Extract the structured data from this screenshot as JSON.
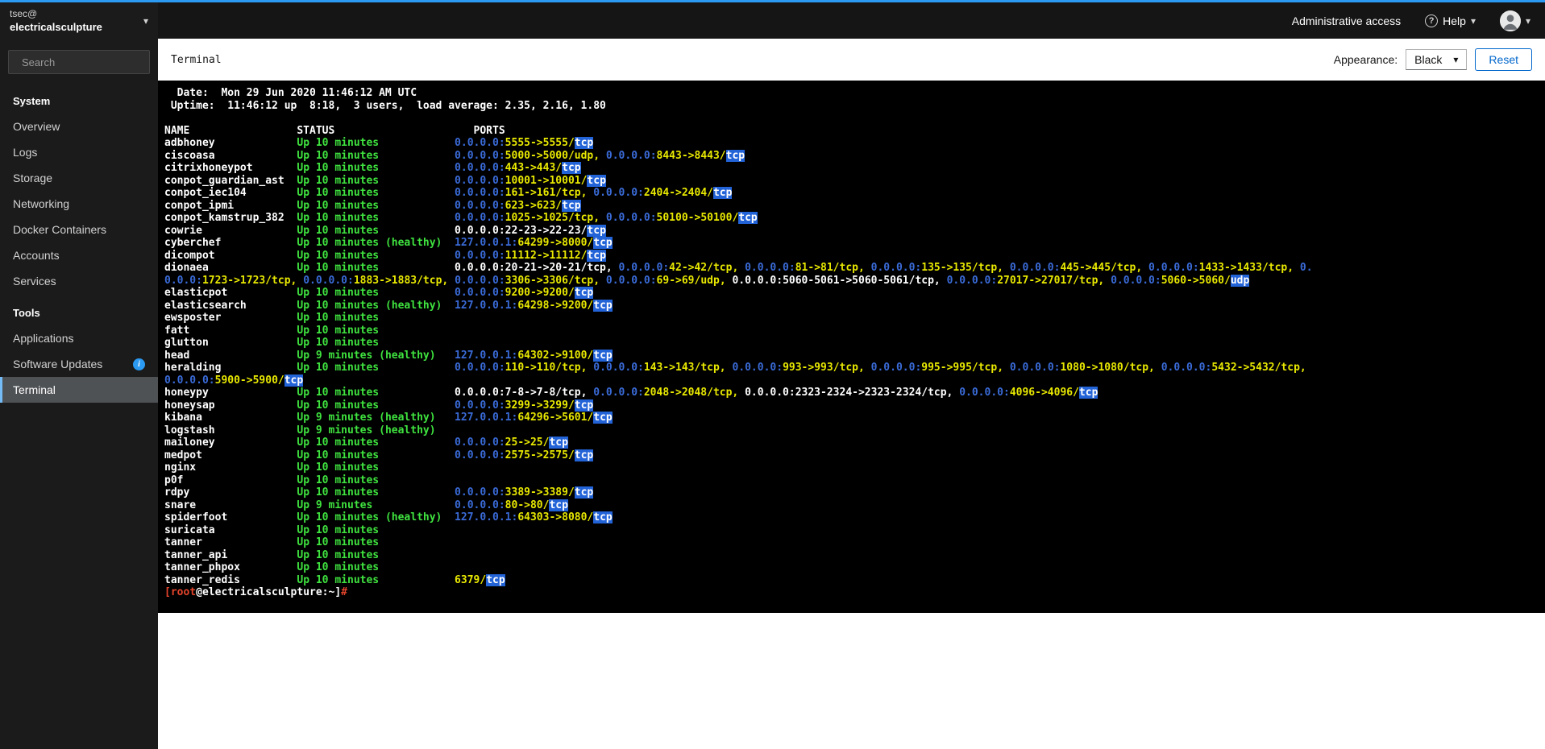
{
  "masthead": {
    "user": "tsec@",
    "host": "electricalsculpture",
    "admin_access": "Administrative access",
    "help_label": "Help"
  },
  "sidebar": {
    "search_placeholder": "Search",
    "sections": [
      {
        "title": "System",
        "items": [
          {
            "label": "Overview"
          },
          {
            "label": "Logs"
          },
          {
            "label": "Storage"
          },
          {
            "label": "Networking"
          },
          {
            "label": "Docker Containers"
          },
          {
            "label": "Accounts"
          },
          {
            "label": "Services"
          }
        ]
      },
      {
        "title": "Tools",
        "items": [
          {
            "label": "Applications"
          },
          {
            "label": "Software Updates",
            "info": true
          },
          {
            "label": "Terminal",
            "active": true
          }
        ]
      }
    ]
  },
  "content_header": {
    "title": "Terminal",
    "appearance_label": "Appearance:",
    "appearance_value": "Black",
    "reset_label": "Reset"
  },
  "colors": {
    "accent_blue": "#2b9af3",
    "link_blue": "#0066cc",
    "terminal_green": "#3fe33f",
    "terminal_yellow": "#e8e800",
    "terminal_blue": "#3a6bd8",
    "terminal_highlight_bg": "#2363d8",
    "terminal_red": "#e5442c"
  },
  "terminal": {
    "lines": [
      [
        [
          "w",
          "  Date:  Mon 29 Jun 2020 11:46:12 AM UTC"
        ]
      ],
      [
        [
          "w",
          " Uptime:  11:46:12 up  8:18,  3 users,  load average: 2.35, 2.16, 1.80"
        ]
      ],
      [],
      [
        [
          "w",
          "NAME                 STATUS                      PORTS"
        ]
      ],
      [
        [
          "w",
          "adbhoney             "
        ],
        [
          "g",
          "Up 10 minutes            "
        ],
        [
          "b",
          "0.0.0.0:"
        ],
        [
          "y",
          "5555->5555/"
        ],
        [
          "h",
          "tcp"
        ]
      ],
      [
        [
          "w",
          "ciscoasa             "
        ],
        [
          "g",
          "Up 10 minutes            "
        ],
        [
          "b",
          "0.0.0.0:"
        ],
        [
          "y",
          "5000->5000/udp, "
        ],
        [
          "b",
          "0.0.0.0:"
        ],
        [
          "y",
          "8443->8443/"
        ],
        [
          "h",
          "tcp"
        ]
      ],
      [
        [
          "w",
          "citrixhoneypot       "
        ],
        [
          "g",
          "Up 10 minutes            "
        ],
        [
          "b",
          "0.0.0.0:"
        ],
        [
          "y",
          "443->443/"
        ],
        [
          "h",
          "tcp"
        ]
      ],
      [
        [
          "w",
          "conpot_guardian_ast  "
        ],
        [
          "g",
          "Up 10 minutes            "
        ],
        [
          "b",
          "0.0.0.0:"
        ],
        [
          "y",
          "10001->10001/"
        ],
        [
          "h",
          "tcp"
        ]
      ],
      [
        [
          "w",
          "conpot_iec104        "
        ],
        [
          "g",
          "Up 10 minutes            "
        ],
        [
          "b",
          "0.0.0.0:"
        ],
        [
          "y",
          "161->161/tcp, "
        ],
        [
          "b",
          "0.0.0.0:"
        ],
        [
          "y",
          "2404->2404/"
        ],
        [
          "h",
          "tcp"
        ]
      ],
      [
        [
          "w",
          "conpot_ipmi          "
        ],
        [
          "g",
          "Up 10 minutes            "
        ],
        [
          "b",
          "0.0.0.0:"
        ],
        [
          "y",
          "623->623/"
        ],
        [
          "h",
          "tcp"
        ]
      ],
      [
        [
          "w",
          "conpot_kamstrup_382  "
        ],
        [
          "g",
          "Up 10 minutes            "
        ],
        [
          "b",
          "0.0.0.0:"
        ],
        [
          "y",
          "1025->1025/tcp, "
        ],
        [
          "b",
          "0.0.0.0:"
        ],
        [
          "y",
          "50100->50100/"
        ],
        [
          "h",
          "tcp"
        ]
      ],
      [
        [
          "w",
          "cowrie               "
        ],
        [
          "g",
          "Up 10 minutes            "
        ],
        [
          "w",
          "0.0.0.0:22-23->22-23/"
        ],
        [
          "h",
          "tcp"
        ]
      ],
      [
        [
          "w",
          "cyberchef            "
        ],
        [
          "g",
          "Up 10 minutes (healthy)  "
        ],
        [
          "b",
          "127.0.0.1:"
        ],
        [
          "y",
          "64299->8000/"
        ],
        [
          "h",
          "tcp"
        ]
      ],
      [
        [
          "w",
          "dicompot             "
        ],
        [
          "g",
          "Up 10 minutes            "
        ],
        [
          "b",
          "0.0.0.0:"
        ],
        [
          "y",
          "11112->11112/"
        ],
        [
          "h",
          "tcp"
        ]
      ],
      [
        [
          "w",
          "dionaea              "
        ],
        [
          "g",
          "Up 10 minutes            "
        ],
        [
          "w",
          "0.0.0.0:20-21->20-21/tcp, "
        ],
        [
          "b",
          "0.0.0.0:"
        ],
        [
          "y",
          "42->42/tcp, "
        ],
        [
          "b",
          "0.0.0.0:"
        ],
        [
          "y",
          "81->81/tcp, "
        ],
        [
          "b",
          "0.0.0.0:"
        ],
        [
          "y",
          "135->135/tcp, "
        ],
        [
          "b",
          "0.0.0.0:"
        ],
        [
          "y",
          "445->445/tcp, "
        ],
        [
          "b",
          "0.0.0.0:"
        ],
        [
          "y",
          "1433->1433/tcp, "
        ],
        [
          "b",
          "0."
        ]
      ],
      [
        [
          "b",
          "0.0.0:"
        ],
        [
          "y",
          "1723->1723/tcp, "
        ],
        [
          "b",
          "0.0.0.0:"
        ],
        [
          "y",
          "1883->1883/tcp, "
        ],
        [
          "b",
          "0.0.0.0:"
        ],
        [
          "y",
          "3306->3306/tcp, "
        ],
        [
          "b",
          "0.0.0.0:"
        ],
        [
          "y",
          "69->69/udp, "
        ],
        [
          "w",
          "0.0.0.0:5060-5061->5060-5061/tcp, "
        ],
        [
          "b",
          "0.0.0.0:"
        ],
        [
          "y",
          "27017->27017/tcp, "
        ],
        [
          "b",
          "0.0.0.0:"
        ],
        [
          "y",
          "5060->5060/"
        ],
        [
          "h",
          "udp"
        ]
      ],
      [
        [
          "w",
          "elasticpot           "
        ],
        [
          "g",
          "Up 10 minutes            "
        ],
        [
          "b",
          "0.0.0.0:"
        ],
        [
          "y",
          "9200->9200/"
        ],
        [
          "h",
          "tcp"
        ]
      ],
      [
        [
          "w",
          "elasticsearch        "
        ],
        [
          "g",
          "Up 10 minutes (healthy)  "
        ],
        [
          "b",
          "127.0.0.1:"
        ],
        [
          "y",
          "64298->9200/"
        ],
        [
          "h",
          "tcp"
        ]
      ],
      [
        [
          "w",
          "ewsposter            "
        ],
        [
          "g",
          "Up 10 minutes"
        ]
      ],
      [
        [
          "w",
          "fatt                 "
        ],
        [
          "g",
          "Up 10 minutes"
        ]
      ],
      [
        [
          "w",
          "glutton              "
        ],
        [
          "g",
          "Up 10 minutes"
        ]
      ],
      [
        [
          "w",
          "head                 "
        ],
        [
          "g",
          "Up 9 minutes (healthy)   "
        ],
        [
          "b",
          "127.0.0.1:"
        ],
        [
          "y",
          "64302->9100/"
        ],
        [
          "h",
          "tcp"
        ]
      ],
      [
        [
          "w",
          "heralding            "
        ],
        [
          "g",
          "Up 10 minutes            "
        ],
        [
          "b",
          "0.0.0.0:"
        ],
        [
          "y",
          "110->110/tcp, "
        ],
        [
          "b",
          "0.0.0.0:"
        ],
        [
          "y",
          "143->143/tcp, "
        ],
        [
          "b",
          "0.0.0.0:"
        ],
        [
          "y",
          "993->993/tcp, "
        ],
        [
          "b",
          "0.0.0.0:"
        ],
        [
          "y",
          "995->995/tcp, "
        ],
        [
          "b",
          "0.0.0.0:"
        ],
        [
          "y",
          "1080->1080/tcp, "
        ],
        [
          "b",
          "0.0.0.0:"
        ],
        [
          "y",
          "5432->5432/tcp,"
        ]
      ],
      [
        [
          "b",
          "0.0.0.0:"
        ],
        [
          "y",
          "5900->5900/"
        ],
        [
          "h",
          "tcp"
        ]
      ],
      [
        [
          "w",
          "honeypy              "
        ],
        [
          "g",
          "Up 10 minutes            "
        ],
        [
          "w",
          "0.0.0.0:7-8->7-8/tcp, "
        ],
        [
          "b",
          "0.0.0.0:"
        ],
        [
          "y",
          "2048->2048/tcp, "
        ],
        [
          "w",
          "0.0.0.0:2323-2324->2323-2324/tcp, "
        ],
        [
          "b",
          "0.0.0.0:"
        ],
        [
          "y",
          "4096->4096/"
        ],
        [
          "h",
          "tcp"
        ]
      ],
      [
        [
          "w",
          "honeysap             "
        ],
        [
          "g",
          "Up 10 minutes            "
        ],
        [
          "b",
          "0.0.0.0:"
        ],
        [
          "y",
          "3299->3299/"
        ],
        [
          "h",
          "tcp"
        ]
      ],
      [
        [
          "w",
          "kibana               "
        ],
        [
          "g",
          "Up 9 minutes (healthy)   "
        ],
        [
          "b",
          "127.0.0.1:"
        ],
        [
          "y",
          "64296->5601/"
        ],
        [
          "h",
          "tcp"
        ]
      ],
      [
        [
          "w",
          "logstash             "
        ],
        [
          "g",
          "Up 9 minutes (healthy)"
        ]
      ],
      [
        [
          "w",
          "mailoney             "
        ],
        [
          "g",
          "Up 10 minutes            "
        ],
        [
          "b",
          "0.0.0.0:"
        ],
        [
          "y",
          "25->25/"
        ],
        [
          "h",
          "tcp"
        ]
      ],
      [
        [
          "w",
          "medpot               "
        ],
        [
          "g",
          "Up 10 minutes            "
        ],
        [
          "b",
          "0.0.0.0:"
        ],
        [
          "y",
          "2575->2575/"
        ],
        [
          "h",
          "tcp"
        ]
      ],
      [
        [
          "w",
          "nginx                "
        ],
        [
          "g",
          "Up 10 minutes"
        ]
      ],
      [
        [
          "w",
          "p0f                  "
        ],
        [
          "g",
          "Up 10 minutes"
        ]
      ],
      [
        [
          "w",
          "rdpy                 "
        ],
        [
          "g",
          "Up 10 minutes            "
        ],
        [
          "b",
          "0.0.0.0:"
        ],
        [
          "y",
          "3389->3389/"
        ],
        [
          "h",
          "tcp"
        ]
      ],
      [
        [
          "w",
          "snare                "
        ],
        [
          "g",
          "Up 9 minutes             "
        ],
        [
          "b",
          "0.0.0.0:"
        ],
        [
          "y",
          "80->80/"
        ],
        [
          "h",
          "tcp"
        ]
      ],
      [
        [
          "w",
          "spiderfoot           "
        ],
        [
          "g",
          "Up 10 minutes (healthy)  "
        ],
        [
          "b",
          "127.0.0.1:"
        ],
        [
          "y",
          "64303->8080/"
        ],
        [
          "h",
          "tcp"
        ]
      ],
      [
        [
          "w",
          "suricata             "
        ],
        [
          "g",
          "Up 10 minutes"
        ]
      ],
      [
        [
          "w",
          "tanner               "
        ],
        [
          "g",
          "Up 10 minutes"
        ]
      ],
      [
        [
          "w",
          "tanner_api           "
        ],
        [
          "g",
          "Up 10 minutes"
        ]
      ],
      [
        [
          "w",
          "tanner_phpox         "
        ],
        [
          "g",
          "Up 10 minutes"
        ]
      ],
      [
        [
          "w",
          "tanner_redis         "
        ],
        [
          "g",
          "Up 10 minutes            "
        ],
        [
          "y",
          "6379/"
        ],
        [
          "h",
          "tcp"
        ]
      ],
      [
        [
          "r",
          "[root"
        ],
        [
          "w",
          "@electricalsculpture:~]"
        ],
        [
          "r",
          "#"
        ],
        [
          "w",
          " "
        ]
      ]
    ]
  }
}
